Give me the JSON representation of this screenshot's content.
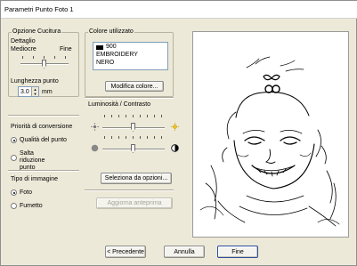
{
  "window": {
    "title": "Parametri Punto Foto 1"
  },
  "stitch_options": {
    "group_label": "Opzione Cucitura",
    "detail_label": "Dettaglio",
    "detail_low": "Mediocre",
    "detail_high": "Fine",
    "length_label": "Lunghezza punto",
    "length_value": "3.0",
    "length_unit": "mm"
  },
  "conversion": {
    "label": "Priorità di conversione",
    "options": [
      "Qualità del punto",
      "Salta riduzione punto"
    ],
    "selected": 0
  },
  "image_type": {
    "label": "Tipo di immagine",
    "options": [
      "Foto",
      "Fumetto"
    ],
    "selected": 0
  },
  "color": {
    "group_label": "Colore utilizzato",
    "swatch": "#000000",
    "code": "900",
    "brand": "EMBROIDERY",
    "name": "NERO",
    "edit_button": "Modifica colore..."
  },
  "adjust": {
    "label": "Luminosità / Contrasto",
    "brightness_icon": "sun-icon",
    "contrast_icon": "contrast-icon",
    "options_button": "Seleziona da opzioni...",
    "update_button": "Aggiorna anteprima"
  },
  "footer": {
    "prev_button": "< Precedente",
    "cancel_button": "Annulla",
    "finish_button": "Fine"
  }
}
